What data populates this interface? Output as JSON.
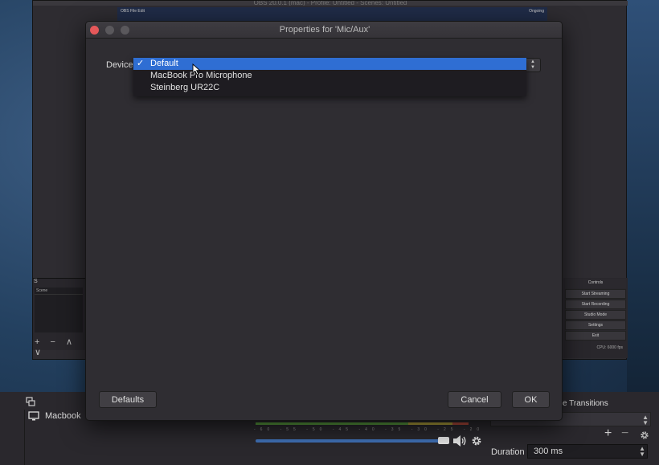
{
  "background_window": {
    "title": "OBS 20.0.1 (mac) - Profile: Untitled - Scenes: Untitled",
    "preview_menubar_left": "OBS  File  Edit",
    "preview_menubar_right": "Ongoing",
    "scenes_dock_title": "S",
    "scenes_header": "Scene",
    "scene_tools": "+ − ∧ ∨",
    "controls": {
      "header": "Controls",
      "buttons": [
        "Start Streaming",
        "Start Recording",
        "Studio Mode",
        "Settings",
        "Exit"
      ],
      "status": "CPU: 6000 fps"
    }
  },
  "lower_window": {
    "source_name": "Macbook",
    "mixer_scale": "-60 -55 -50 -45 -40 -35 -30 -25 -20 -15 -10 -5 0",
    "transitions_title": "e Transitions",
    "duration_label": "Duration",
    "duration_value": "300 ms"
  },
  "dialog": {
    "title": "Properties for 'Mic/Aux'",
    "device_label": "Device",
    "device_options": [
      {
        "label": "Default",
        "selected": true
      },
      {
        "label": "MacBook Pro Microphone",
        "selected": false
      },
      {
        "label": "Steinberg UR22C",
        "selected": false
      }
    ],
    "check_glyph": "✓",
    "defaults_label": "Defaults",
    "cancel_label": "Cancel",
    "ok_label": "OK"
  },
  "colors": {
    "selection": "#2f6ed3",
    "close_button": "#e5585a",
    "dialog_bg": "#2f2d32",
    "meter_green": "#5a9d3e",
    "volume_blue": "#3f6fb5"
  },
  "icons": [
    "close-traffic-light",
    "minimize-traffic-light",
    "zoom-traffic-light",
    "checkmark-icon",
    "mouse-cursor-icon",
    "monitor-icon",
    "speaker-icon",
    "gear-icon",
    "sources-icon",
    "updown-chevron-icon"
  ]
}
